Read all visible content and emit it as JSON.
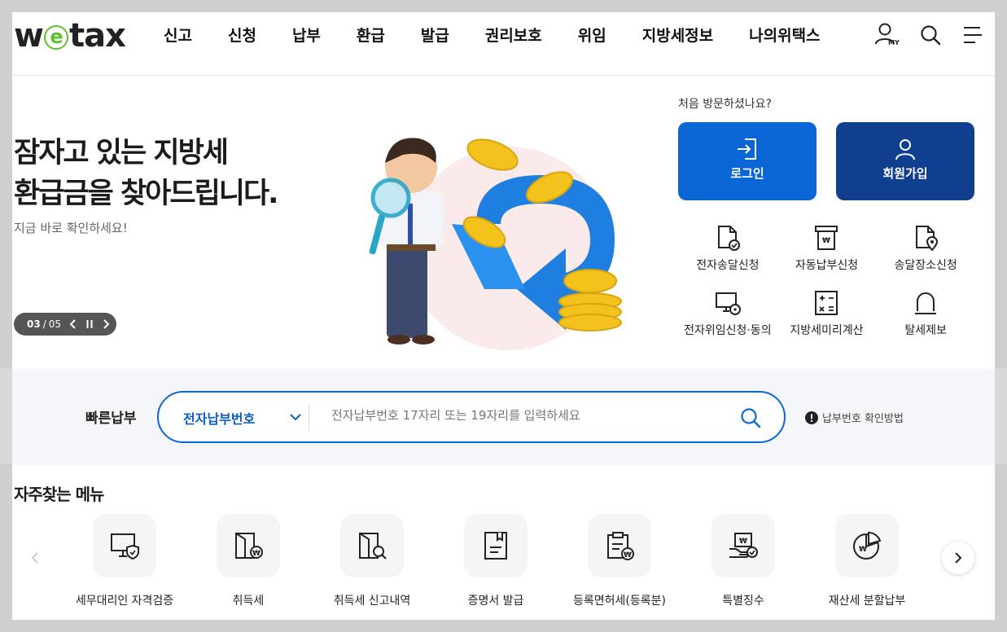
{
  "header": {
    "logo_pre": "w",
    "logo_e": "e",
    "logo_post": "tax",
    "nav": [
      "신고",
      "신청",
      "납부",
      "환급",
      "발급",
      "권리보호",
      "위임",
      "지방세정보",
      "나의위택스"
    ],
    "my_label": "MY"
  },
  "hero": {
    "title_line1": "잠자고 있는 지방세",
    "title_line2": "환급금을 찾아드립니다.",
    "subtitle": "지금 바로 확인하세요!",
    "slide_current": "03",
    "slide_sep": "/",
    "slide_total": "05"
  },
  "quick_panel": {
    "first_visit": "처음 방문하셨나요?",
    "login_label": "로그인",
    "join_label": "회원가입",
    "items": [
      {
        "label": "전자송달신청",
        "icon": "doc-check-icon"
      },
      {
        "label": "자동납부신청",
        "icon": "auto-pay-icon"
      },
      {
        "label": "송달장소신청",
        "icon": "doc-location-icon"
      },
      {
        "label": "전자위임신청·동의",
        "icon": "monitor-lock-icon"
      },
      {
        "label": "지방세미리계산",
        "icon": "calculator-icon"
      },
      {
        "label": "탈세제보",
        "icon": "siren-icon"
      }
    ]
  },
  "quick_pay": {
    "label": "빠른납부",
    "select_value": "전자납부번호",
    "placeholder": "전자납부번호 17자리 또는 19자리를 입력하세요",
    "help_text": "납부번호 확인방법"
  },
  "frequent_menu": {
    "title": "자주찾는 메뉴",
    "items": [
      {
        "label": "세무대리인 자격검증",
        "icon": "monitor-shield-icon"
      },
      {
        "label": "취득세",
        "icon": "folder-won-icon"
      },
      {
        "label": "취득세 신고내역",
        "icon": "folder-search-icon"
      },
      {
        "label": "증명서 발급",
        "icon": "certificate-icon"
      },
      {
        "label": "등록면허세(등록분)",
        "icon": "clipboard-won-icon"
      },
      {
        "label": "특별징수",
        "icon": "hand-won-icon"
      },
      {
        "label": "재산세 분할납부",
        "icon": "pie-won-icon"
      }
    ]
  },
  "colors": {
    "primary": "#0a66d4",
    "dark_primary": "#0f3f8e",
    "logo_green": "#5cc12c"
  }
}
